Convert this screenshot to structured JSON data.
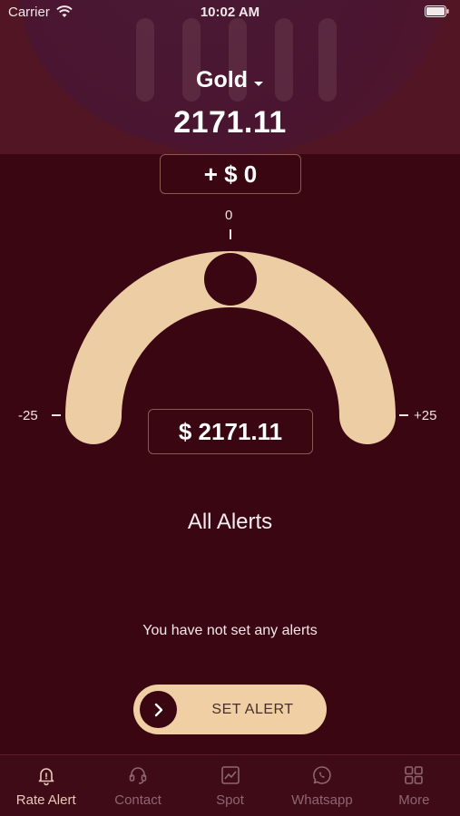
{
  "status_bar": {
    "carrier": "Carrier",
    "time": "10:02 AM"
  },
  "header": {
    "metal": "Gold",
    "price": "2171.11"
  },
  "offset": {
    "label": "+ $ 0"
  },
  "gauge": {
    "min_label": "-25",
    "center_label": "0",
    "max_label": "+25",
    "target_price": "$ 2171.11",
    "offset_value": 0,
    "range": [
      -25,
      25
    ]
  },
  "alerts": {
    "title": "All Alerts",
    "empty_message": "You have not set any alerts"
  },
  "set_alert": {
    "label": "SET ALERT"
  },
  "tabs": [
    {
      "label": "Rate Alert",
      "icon": "bell-icon",
      "active": true
    },
    {
      "label": "Contact",
      "icon": "headset-icon",
      "active": false
    },
    {
      "label": "Spot",
      "icon": "chart-icon",
      "active": false
    },
    {
      "label": "Whatsapp",
      "icon": "whatsapp-icon",
      "active": false
    },
    {
      "label": "More",
      "icon": "grid-icon",
      "active": false
    }
  ],
  "colors": {
    "background": "#3a0612",
    "header": "#521524",
    "accent": "#efcfa3",
    "tab_inactive": "#8e6670",
    "tab_active": "#e8c9b9"
  }
}
